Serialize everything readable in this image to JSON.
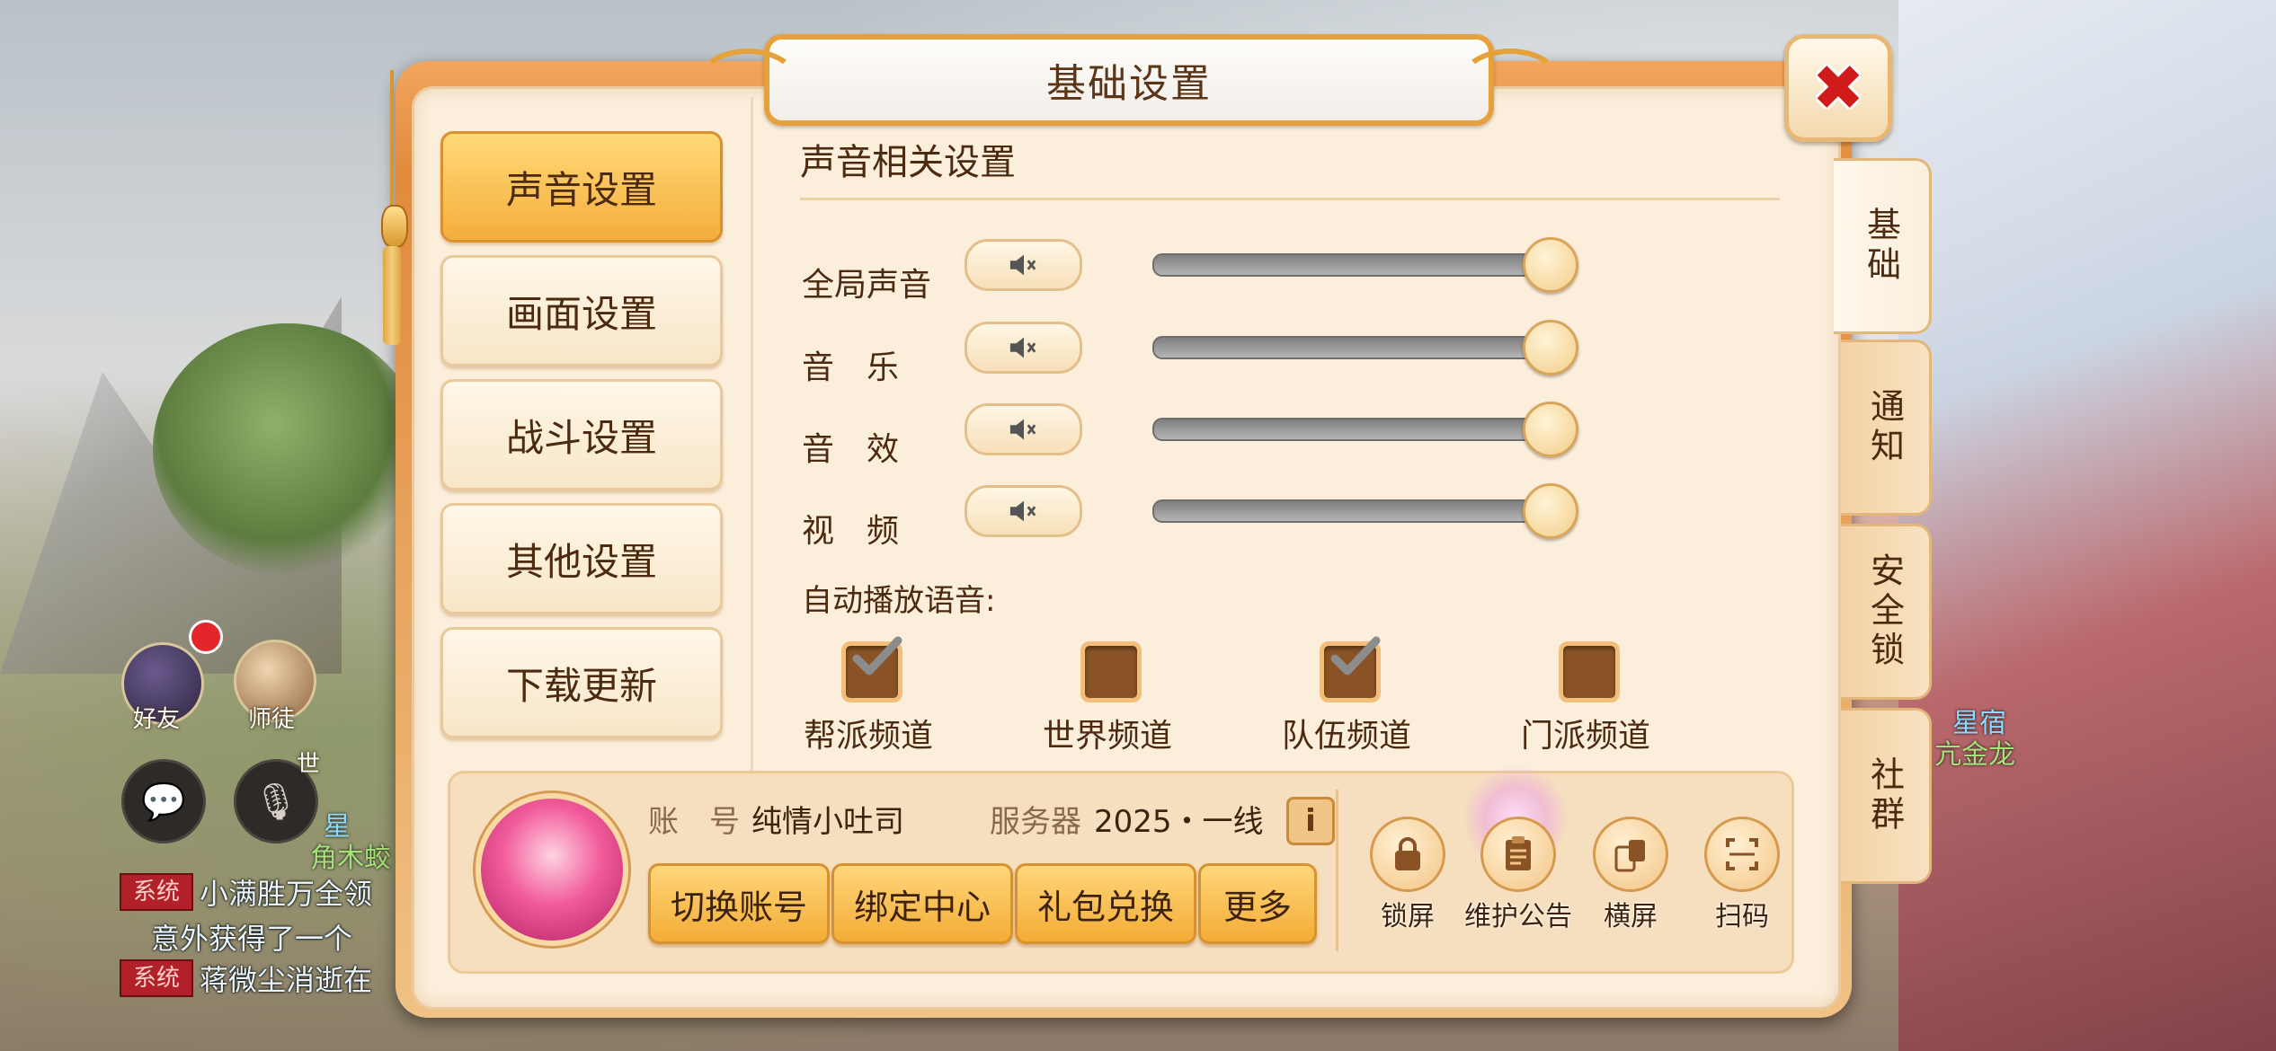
{
  "dialog": {
    "title": "基础设置",
    "close_label": "✖"
  },
  "menu": {
    "items": [
      {
        "label": "声音设置",
        "active": true
      },
      {
        "label": "画面设置",
        "active": false
      },
      {
        "label": "战斗设置",
        "active": false
      },
      {
        "label": "其他设置",
        "active": false
      },
      {
        "label": "下载更新",
        "active": false
      }
    ]
  },
  "side_tabs": [
    {
      "label": "基础",
      "active": true
    },
    {
      "label": "通知",
      "active": false
    },
    {
      "label": "安全锁",
      "active": false
    },
    {
      "label": "社群",
      "active": false
    }
  ],
  "sound": {
    "section_title": "声音相关设置",
    "rows": [
      {
        "label": "全局声音",
        "muted_icon": "speaker-mute-icon",
        "level": 1.0
      },
      {
        "label": "音　乐",
        "muted_icon": "speaker-mute-icon",
        "level": 1.0
      },
      {
        "label": "音　效",
        "muted_icon": "speaker-mute-icon",
        "level": 1.0
      },
      {
        "label": "视　频",
        "muted_icon": "speaker-mute-icon",
        "level": 1.0
      }
    ],
    "auto_play_label": "自动播放语音:",
    "channels": [
      {
        "label": "帮派频道",
        "checked": true
      },
      {
        "label": "世界频道",
        "checked": false
      },
      {
        "label": "队伍频道",
        "checked": true
      },
      {
        "label": "门派频道",
        "checked": false
      }
    ]
  },
  "account": {
    "account_key": "账　号",
    "account_value": "纯情小吐司",
    "server_key": "服务器",
    "server_value": "2025・一线",
    "info_label": "i",
    "buttons": [
      "切换账号",
      "绑定中心",
      "礼包兑换",
      "更多"
    ],
    "tools": [
      {
        "label": "锁屏",
        "icon": "lock-icon"
      },
      {
        "label": "维护公告",
        "icon": "clipboard-icon"
      },
      {
        "label": "横屏",
        "icon": "rotate-screen-icon"
      },
      {
        "label": "扫码",
        "icon": "scan-icon"
      }
    ]
  },
  "hud": {
    "friend_label": "好友",
    "master_label": "师徒",
    "world_label": "世",
    "npc_name_1": "星",
    "npc_name_1b": "角木蛟",
    "npc_name_2": "星宿",
    "npc_name_2b": "亢金龙",
    "chat": [
      {
        "tag": "系统",
        "text": "小满胜万全领"
      },
      {
        "tag": "",
        "text": "意外获得了一个"
      },
      {
        "tag": "系统",
        "text": "蒋微尘消逝在"
      }
    ],
    "colors": {
      "accent": "#f4ae3c",
      "close_red": "#d11a1a",
      "chat_tag": "#b2202a"
    }
  }
}
